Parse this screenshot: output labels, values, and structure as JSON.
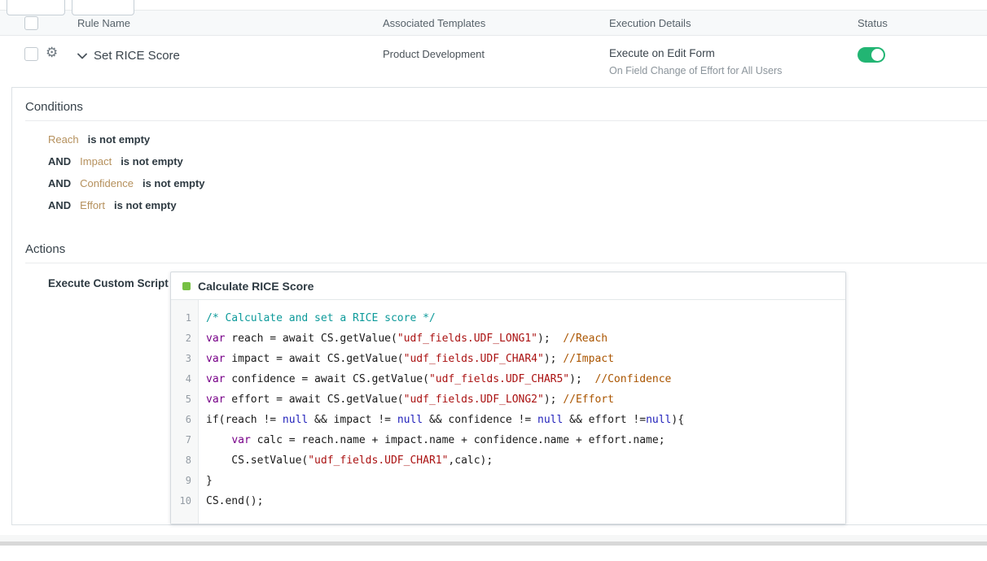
{
  "colors": {
    "toggle-on": "#22b573",
    "script-indicator": "#76c043",
    "field-link": "#b5905c",
    "code-keyword": "#770088",
    "code-string": "#aa1111",
    "code-comment": "#aa5500",
    "code-atom": "#2222bb",
    "code-blockcomment": "#0d9a9a"
  },
  "table": {
    "headers": [
      "Rule Name",
      "Associated Templates",
      "Execution Details",
      "Status"
    ],
    "row": {
      "rule_name": "Set RICE Score",
      "associated_templates": "Product Development",
      "execution_title": "Execute on Edit Form",
      "execution_subtitle": "On Field Change of Effort for All Users",
      "status_enabled": "on"
    }
  },
  "panel": {
    "conditions": {
      "title": "Conditions",
      "items": [
        {
          "operator": "",
          "field": "Reach",
          "predicate": "is not empty"
        },
        {
          "operator": "AND",
          "field": "Impact",
          "predicate": "is not empty"
        },
        {
          "operator": "AND",
          "field": "Confidence",
          "predicate": "is not empty"
        },
        {
          "operator": "AND",
          "field": "Effort",
          "predicate": "is not empty"
        }
      ]
    },
    "actions": {
      "title": "Actions",
      "action_label": "Execute Custom Script",
      "script": {
        "title": "Calculate RICE Score",
        "lines": [
          {
            "no": 1,
            "tokens": [
              {
                "t": "/* Calculate and set a RICE score */",
                "c": "bc"
              }
            ]
          },
          {
            "no": 2,
            "tokens": [
              {
                "t": "var",
                "c": "k"
              },
              {
                "t": " reach = await CS.getValue(",
                "c": "p"
              },
              {
                "t": "\"udf_fields.UDF_LONG1\"",
                "c": "s"
              },
              {
                "t": ");  ",
                "c": "p"
              },
              {
                "t": "//Reach",
                "c": "c"
              }
            ]
          },
          {
            "no": 3,
            "tokens": [
              {
                "t": "var",
                "c": "k"
              },
              {
                "t": " impact = await CS.getValue(",
                "c": "p"
              },
              {
                "t": "\"udf_fields.UDF_CHAR4\"",
                "c": "s"
              },
              {
                "t": "); ",
                "c": "p"
              },
              {
                "t": "//Impact",
                "c": "c"
              }
            ]
          },
          {
            "no": 4,
            "tokens": [
              {
                "t": "var",
                "c": "k"
              },
              {
                "t": " confidence = await CS.getValue(",
                "c": "p"
              },
              {
                "t": "\"udf_fields.UDF_CHAR5\"",
                "c": "s"
              },
              {
                "t": ");  ",
                "c": "p"
              },
              {
                "t": "//Confidence",
                "c": "c"
              }
            ]
          },
          {
            "no": 5,
            "tokens": [
              {
                "t": "var",
                "c": "k"
              },
              {
                "t": " effort = await CS.getValue(",
                "c": "p"
              },
              {
                "t": "\"udf_fields.UDF_LONG2\"",
                "c": "s"
              },
              {
                "t": "); ",
                "c": "p"
              },
              {
                "t": "//Effort",
                "c": "c"
              }
            ]
          },
          {
            "no": 6,
            "tokens": [
              {
                "t": "if(reach != ",
                "c": "p"
              },
              {
                "t": "null",
                "c": "a"
              },
              {
                "t": " && impact != ",
                "c": "p"
              },
              {
                "t": "null",
                "c": "a"
              },
              {
                "t": " && confidence != ",
                "c": "p"
              },
              {
                "t": "null",
                "c": "a"
              },
              {
                "t": " && effort !=",
                "c": "p"
              },
              {
                "t": "null",
                "c": "a"
              },
              {
                "t": "){",
                "c": "p"
              }
            ]
          },
          {
            "no": 7,
            "tokens": [
              {
                "t": "    ",
                "c": "p"
              },
              {
                "t": "var",
                "c": "k"
              },
              {
                "t": " calc = reach.name + impact.name + confidence.name + effort.name;",
                "c": "p"
              }
            ]
          },
          {
            "no": 8,
            "tokens": [
              {
                "t": "    CS.setValue(",
                "c": "p"
              },
              {
                "t": "\"udf_fields.UDF_CHAR1\"",
                "c": "s"
              },
              {
                "t": ",calc);",
                "c": "p"
              }
            ]
          },
          {
            "no": 9,
            "tokens": [
              {
                "t": "}",
                "c": "p"
              }
            ]
          },
          {
            "no": 10,
            "tokens": [
              {
                "t": "CS.end();",
                "c": "p"
              }
            ]
          }
        ]
      }
    }
  }
}
